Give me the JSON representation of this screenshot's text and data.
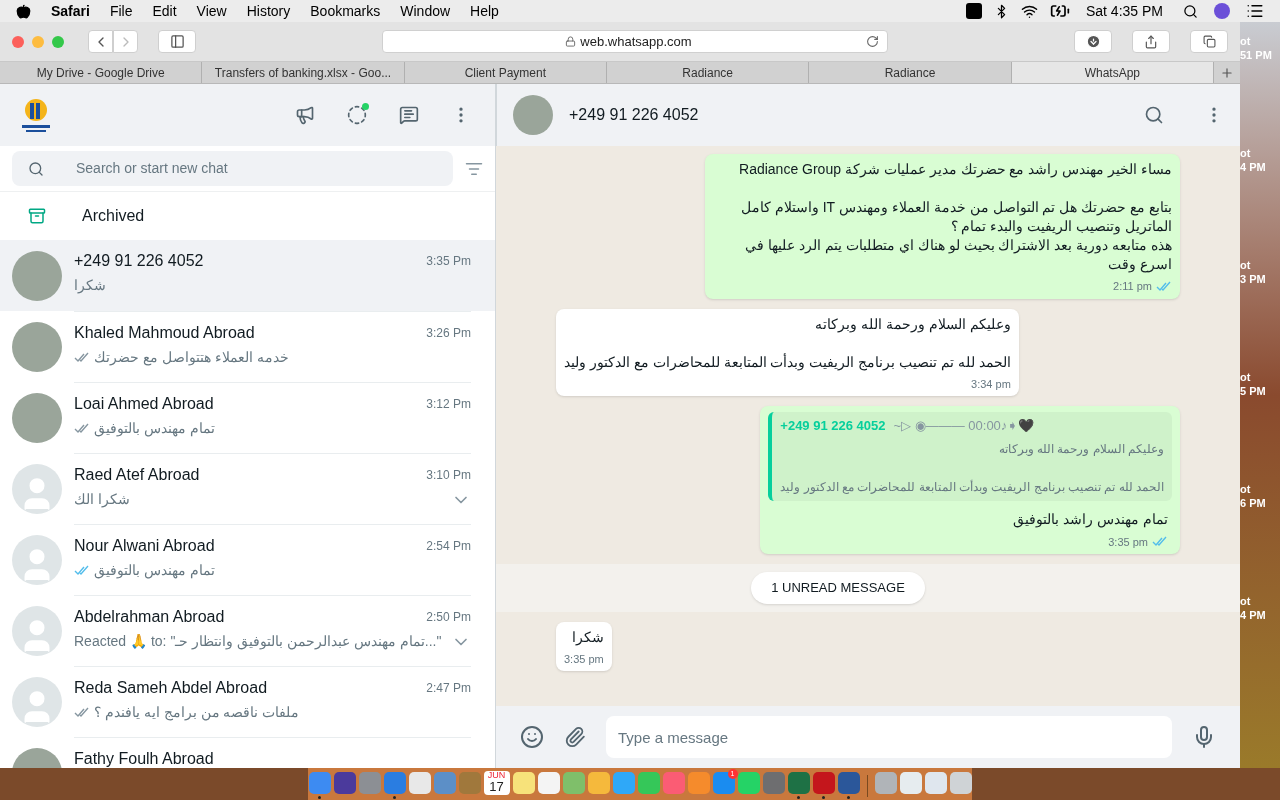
{
  "menu_bar": {
    "app": "Safari",
    "menus": [
      "File",
      "Edit",
      "View",
      "History",
      "Bookmarks",
      "Window",
      "Help"
    ],
    "clock": "Sat 4:35 PM"
  },
  "browser": {
    "url": "web.whatsapp.com",
    "tabs": [
      {
        "label": "My Drive - Google Drive",
        "selected": false
      },
      {
        "label": "Transfers of banking.xlsx - Goo...",
        "selected": false
      },
      {
        "label": "Client Payment",
        "selected": false
      },
      {
        "label": "Radiance",
        "selected": false
      },
      {
        "label": "Radiance",
        "selected": false
      },
      {
        "label": "WhatsApp",
        "selected": true
      }
    ]
  },
  "sidebar": {
    "search": {
      "placeholder": "Search or start new chat"
    },
    "archived": "Archived",
    "chats": [
      {
        "name": "+249 91 226 4052",
        "time": "3:35 Pm",
        "preview": "شكرا",
        "photo": true,
        "ticks": false,
        "selected": true,
        "chevron": false
      },
      {
        "name": "Khaled Mahmoud Abroad",
        "time": "3:26 Pm",
        "preview": "خدمه العملاء هتتواصل مع حضرتك",
        "photo": true,
        "ticks": true,
        "read": false,
        "selected": false,
        "chevron": false
      },
      {
        "name": "Loai Ahmed Abroad",
        "time": "3:12 Pm",
        "preview": "تمام مهندس بالتوفيق",
        "photo": true,
        "ticks": true,
        "read": false,
        "selected": false,
        "chevron": false
      },
      {
        "name": "Raed Atef Abroad",
        "time": "3:10 Pm",
        "preview": "شكرا الك",
        "photo": false,
        "ticks": false,
        "selected": false,
        "chevron": true
      },
      {
        "name": "Nour Alwani Abroad",
        "time": "2:54 Pm",
        "preview": "تمام مهندس بالتوفيق",
        "photo": false,
        "ticks": true,
        "read": true,
        "selected": false,
        "chevron": false
      },
      {
        "name": "Abdelrahman Abroad",
        "time": "2:50 Pm",
        "preview": "Reacted 🙏 to: \"تمام مهندس عبدالرحمن بالتوفيق وانتظار حـ...\"",
        "photo": false,
        "ticks": false,
        "selected": false,
        "chevron": true
      },
      {
        "name": "Reda Sameh Abdel Abroad",
        "time": "2:47 Pm",
        "preview": "ملفات ناقصه من برامج ايه يافندم ؟",
        "photo": false,
        "ticks": true,
        "read": false,
        "selected": false,
        "chevron": false
      },
      {
        "name": "Fathy Foulh Abroad",
        "photo": true,
        "selected": false
      }
    ]
  },
  "chat": {
    "title": "+249 91 226 4052",
    "messages": [
      {
        "kind": "text",
        "outgoing": true,
        "text": "مساء الخير مهندس راشد مع حضرتك مدير عمليات شركة Radiance Group\n\nبتابع مع حضرتك هل تم التواصل من خدمة العملاء ومهندس IT واستلام كامل الماتريل وتنصيب الريفيت والبدء تمام ؟\nهذه متابعه دورية بعد الاشتراك بحيث لو هناك اي متطلبات يتم الرد عليها في اسرع وقت",
        "time": "2:11 pm",
        "ticks": true,
        "read": true
      },
      {
        "kind": "text",
        "outgoing": false,
        "text": "وعليكم السلام ورحمة الله وبركاته\n\nالحمد لله تم تنصيب برنامج الريفيت وبدأت المتابعة للمحاضرات مع الدكتور وليد",
        "time": "3:34 pm",
        "ticks": false
      },
      {
        "kind": "reply",
        "outgoing": true,
        "quote_author": "+249 91 226 4052",
        "quote_pushname": "~▷ ◉——— 00:00♪➧🖤",
        "quote_text": "وعليكم السلام ورحمة الله وبركاته\n\nالحمد لله تم تنصيب برنامج الريفيت وبدأت المتابعة للمحاضرات مع الدكتور وليد",
        "text": "تمام مهندس راشد بالتوفيق",
        "time": "3:35 pm",
        "ticks": true,
        "read": true
      },
      {
        "kind": "divider",
        "text": "1 UNREAD MESSAGE"
      },
      {
        "kind": "text",
        "outgoing": false,
        "text": "شكرا",
        "time": "3:35 pm",
        "ticks": false
      }
    ],
    "composer": {
      "placeholder": "Type a message"
    }
  },
  "desktop": {
    "labels": [
      {
        "line_1": "ot",
        "line_2": "51 PM"
      },
      {
        "line_1": "ot",
        "line_2": "4 PM"
      },
      {
        "line_1": "ot",
        "line_2": "3 PM"
      },
      {
        "line_1": "ot",
        "line_2": "5 PM"
      },
      {
        "line_1": "ot",
        "line_2": "6 PM"
      },
      {
        "line_1": "ot",
        "line_2": "4 PM"
      }
    ]
  },
  "dock": {
    "items": [
      {
        "kind": "app",
        "color": "#3d8bf2",
        "running": true
      },
      {
        "kind": "app",
        "color": "#4b3a9c",
        "running": false
      },
      {
        "kind": "app",
        "color": "#8c8f94",
        "running": false
      },
      {
        "kind": "app",
        "color": "#2a7de1",
        "running": true
      },
      {
        "kind": "app",
        "color": "#e8e8e8",
        "running": false
      },
      {
        "kind": "app",
        "color": "#5c8fc7",
        "running": false
      },
      {
        "kind": "app",
        "color": "#a0783c",
        "running": false
      },
      {
        "kind": "calendar",
        "month": "JUN",
        "day": "17",
        "running": false
      },
      {
        "kind": "app",
        "color": "#f7e27a",
        "running": false
      },
      {
        "kind": "app",
        "color": "#f4f4f4",
        "running": false
      },
      {
        "kind": "app",
        "color": "#7fbf6a",
        "running": false
      },
      {
        "kind": "app",
        "color": "#f5b93c",
        "running": false
      },
      {
        "kind": "app",
        "color": "#2fa8f8",
        "running": false
      },
      {
        "kind": "app",
        "color": "#35c759",
        "running": false
      },
      {
        "kind": "app",
        "color": "#fb5c74",
        "running": false
      },
      {
        "kind": "app",
        "color": "#f58b2c",
        "running": false
      },
      {
        "kind": "app",
        "color": "#1a8cf0",
        "running": false,
        "badge": "1"
      },
      {
        "kind": "app",
        "color": "#25d366",
        "running": false
      },
      {
        "kind": "app",
        "color": "#6e6e70",
        "running": false
      },
      {
        "kind": "app",
        "color": "#1e7145",
        "running": true
      },
      {
        "kind": "app",
        "color": "#c4161c",
        "running": true
      },
      {
        "kind": "app",
        "color": "#2b579a",
        "running": true
      },
      {
        "kind": "separator"
      },
      {
        "kind": "app",
        "color": "#b0b4b8",
        "running": false
      },
      {
        "kind": "app",
        "color": "#e6ecef",
        "running": false
      },
      {
        "kind": "app",
        "color": "#dfe6ee",
        "running": false
      },
      {
        "kind": "app",
        "color": "#cfd3d6",
        "running": false
      }
    ]
  }
}
